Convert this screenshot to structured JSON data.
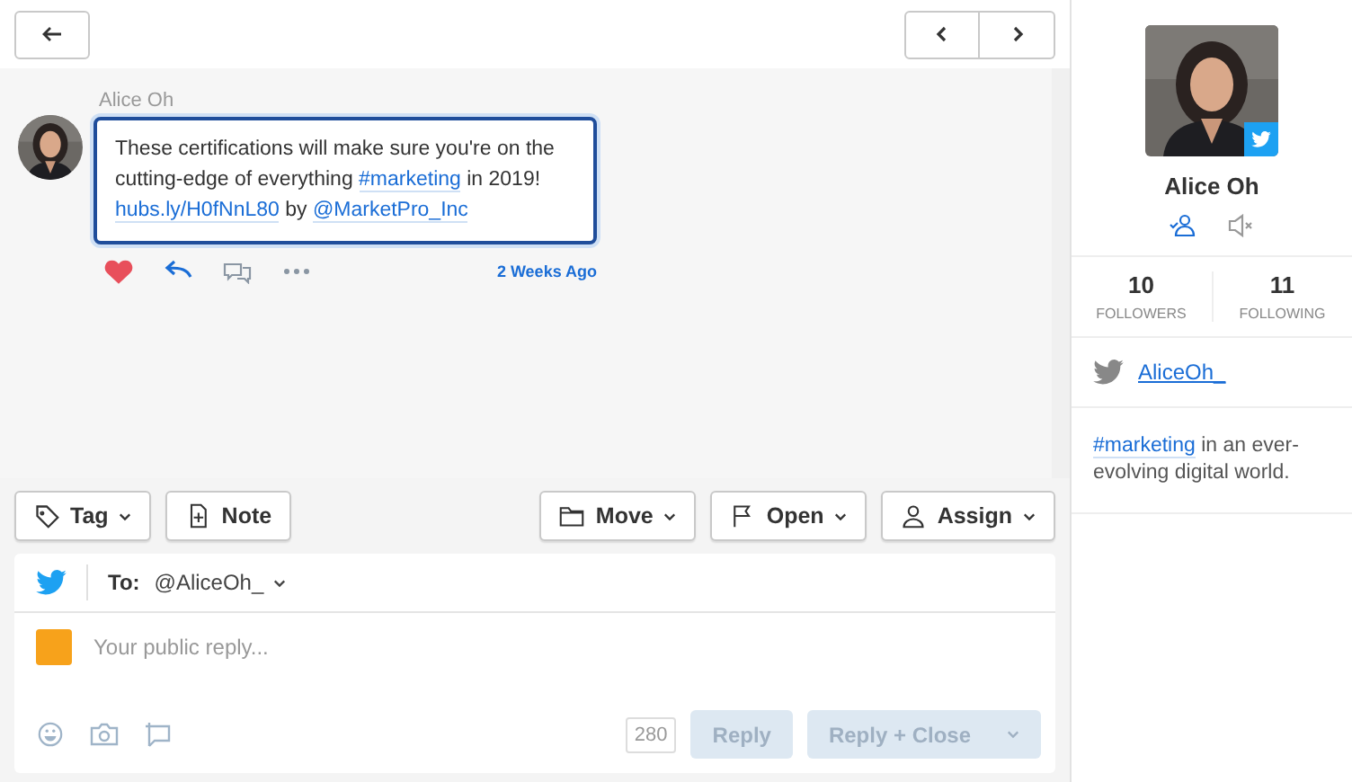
{
  "message": {
    "author": "Alice Oh",
    "parts": [
      {
        "kind": "text",
        "text": "These certifications will make sure you're on the cutting-edge of everything "
      },
      {
        "kind": "link",
        "text": "#marketing"
      },
      {
        "kind": "text",
        "text": " in 2019! "
      },
      {
        "kind": "link",
        "text": "hubs.ly/H0fNnL80"
      },
      {
        "kind": "text",
        "text": " by "
      },
      {
        "kind": "link",
        "text": "@MarketPro_Inc"
      }
    ],
    "liked": true,
    "time": "2 Weeks Ago"
  },
  "toolbar": {
    "left": [
      {
        "label": "Tag",
        "dropdown": true
      },
      {
        "label": "Note",
        "dropdown": false
      }
    ],
    "right": [
      {
        "label": "Move",
        "dropdown": true
      },
      {
        "label": "Open",
        "dropdown": true
      },
      {
        "label": "Assign",
        "dropdown": true
      }
    ]
  },
  "composer": {
    "to_label": "To:",
    "to_value": "@AliceOh_",
    "placeholder": "Your public reply...",
    "char_count": "280",
    "reply": {
      "label": "Reply",
      "disabled": true
    },
    "reply_close": {
      "label": "Reply + Close",
      "disabled": true
    }
  },
  "profile": {
    "name": "Alice Oh",
    "followers": "10",
    "followers_label": "FOLLOWERS",
    "following": "11",
    "following_label": "FOLLOWING",
    "handle": "AliceOh_",
    "bio_tag": "#marketing",
    "bio": " in an ever-evolving digital world."
  }
}
